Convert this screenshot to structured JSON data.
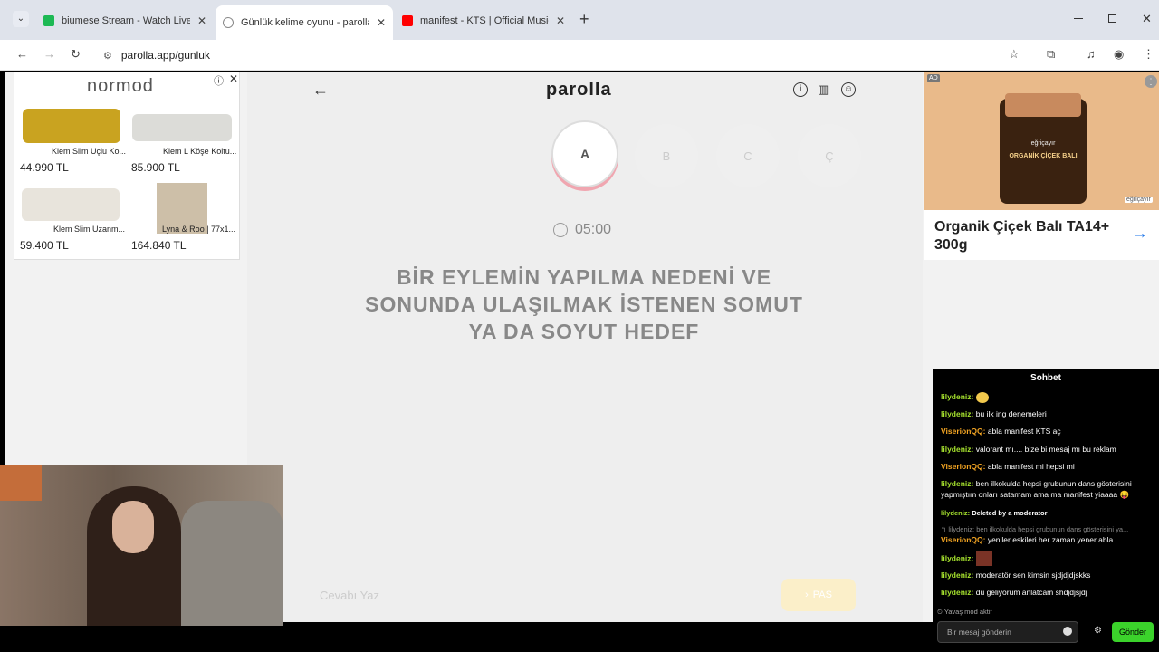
{
  "browser": {
    "tabs": [
      {
        "title": "biumese Stream - Watch Live on Kick",
        "active": false,
        "favicon_color": "#1db954"
      },
      {
        "title": "Günlük kelime oyunu - parolla",
        "active": true,
        "favicon_color": "#888888"
      },
      {
        "title": "manifest - KTS | Official Music Video",
        "active": false,
        "favicon_color": "#ff0000"
      }
    ],
    "new_tab_glyph": "+",
    "url": "parolla.app/gunluk"
  },
  "left_ad": {
    "brand": "normod",
    "products": [
      {
        "name": "Klem Slim Uçlu Ko...",
        "price": "44.990 TL"
      },
      {
        "name": "Klem L Köşe Koltu...",
        "price": "85.900 TL"
      },
      {
        "name": "Klem Slim Uzanm...",
        "price": "59.400 TL"
      },
      {
        "name": "Lyna & Roo | 77x1...",
        "price": "164.840 TL"
      }
    ]
  },
  "game": {
    "logo": "parolla",
    "letters": [
      "A",
      "B",
      "C",
      "Ç"
    ],
    "timer": "05:00",
    "question": "BİR EYLEMİN YAPILMA NEDENİ VE SONUNDA ULAŞILMAK İSTENEN SOMUT YA DA SOYUT HEDEF",
    "input_placeholder": "Cevabı Yaz",
    "pass_label": "PAS"
  },
  "right_ad": {
    "badge": "AD",
    "jar_brand": "eğriçayır",
    "jar_product": "ORGANİK ÇİÇEK BALI",
    "watermark": "eğriçayır",
    "title": "Organik Çiçek Balı TA14+ 300g"
  },
  "chat": {
    "title": "Sohbet",
    "messages": [
      {
        "user": "lilydeniz:",
        "text": "",
        "user_color": "green",
        "emote": true
      },
      {
        "user": "lilydeniz:",
        "text": "bu ilk ing denemeleri",
        "user_color": "green"
      },
      {
        "user": "ViserionQQ:",
        "text": "abla manifest KTS aç",
        "user_color": "orange"
      },
      {
        "user": "lilydeniz:",
        "text": "valorant mı.... bize bi mesaj mı bu reklam",
        "user_color": "green"
      },
      {
        "user": "ViserionQQ:",
        "text": "abla manifest mi hepsi mi",
        "user_color": "orange"
      },
      {
        "user": "lilydeniz:",
        "text": "ben ilkokulda hepsi grubunun dans gösterisini yapmıştım onları satamam ama ma manifest yiaaaa 😝",
        "user_color": "green"
      },
      {
        "user": "lilydeniz:",
        "text": "Deleted by a moderator",
        "user_color": "green"
      },
      {
        "reply": "↰ lilydeniz: ben ilkokulda hepsi grubunun dans gösterisini ya..."
      },
      {
        "user": "ViserionQQ:",
        "text": "yeniler eskileri her zaman yener abla",
        "user_color": "orange"
      },
      {
        "user": "lilydeniz:",
        "text": "",
        "user_color": "green",
        "emote": true
      },
      {
        "user": "lilydeniz:",
        "text": "moderatör sen kimsin sjdjdjdjskks",
        "user_color": "green"
      },
      {
        "user": "lilydeniz:",
        "text": "du geliyorum anlatcam shdjdjsjdj",
        "user_color": "green"
      }
    ],
    "slow_mode": "Yavaş mod aktif",
    "input_placeholder": "Bir mesaj gönderin",
    "send_label": "Gönder"
  },
  "colors": {
    "accent_green": "#3bd32b",
    "pass_yellow": "#fbefc9",
    "letter_ring": "#f0a6b0"
  }
}
